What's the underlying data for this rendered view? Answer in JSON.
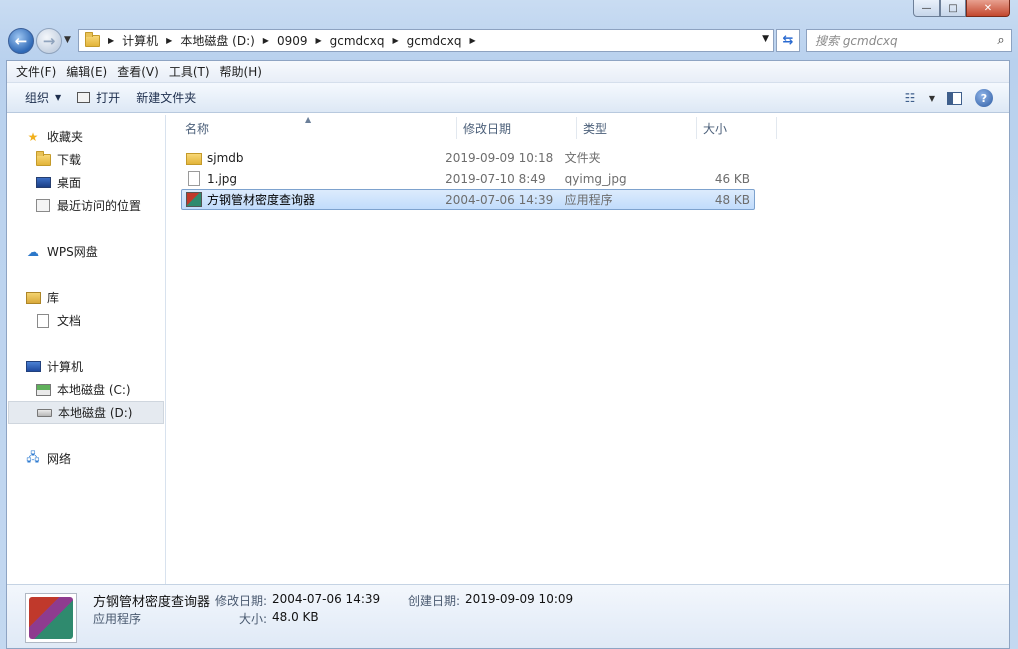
{
  "window": {
    "controls": {
      "minimize": "—",
      "maximize": "□",
      "close": "✕"
    }
  },
  "nav": {
    "breadcrumbs": [
      "计算机",
      "本地磁盘 (D:)",
      "0909",
      "gcmdcxq",
      "gcmdcxq"
    ],
    "search_placeholder": "搜索 gcmdcxq"
  },
  "menu": [
    "文件(F)",
    "编辑(E)",
    "查看(V)",
    "工具(T)",
    "帮助(H)"
  ],
  "toolbar": {
    "organize": "组织",
    "open": "打开",
    "new_folder": "新建文件夹"
  },
  "sidebar": {
    "favorites": {
      "label": "收藏夹",
      "items": [
        "下载",
        "桌面",
        "最近访问的位置"
      ]
    },
    "wps": "WPS网盘",
    "library": {
      "label": "库",
      "items": [
        "文档"
      ]
    },
    "computer": {
      "label": "计算机",
      "items": [
        "本地磁盘 (C:)",
        "本地磁盘 (D:)"
      ]
    },
    "network": "网络"
  },
  "columns": {
    "name": "名称",
    "date": "修改日期",
    "type": "类型",
    "size": "大小"
  },
  "files": [
    {
      "name": "sjmdb",
      "date": "2019-09-09 10:18",
      "type": "文件夹",
      "size": ""
    },
    {
      "name": "1.jpg",
      "date": "2019-07-10 8:49",
      "type": "qyimg_jpg",
      "size": "46 KB"
    },
    {
      "name": "方钢管材密度查询器",
      "date": "2004-07-06 14:39",
      "type": "应用程序",
      "size": "48 KB"
    }
  ],
  "details": {
    "name": "方钢管材密度查询器",
    "type": "应用程序",
    "modified_label": "修改日期:",
    "modified": "2004-07-06 14:39",
    "created_label": "创建日期:",
    "created": "2019-09-09 10:09",
    "size_label": "大小:",
    "size": "48.0 KB"
  }
}
